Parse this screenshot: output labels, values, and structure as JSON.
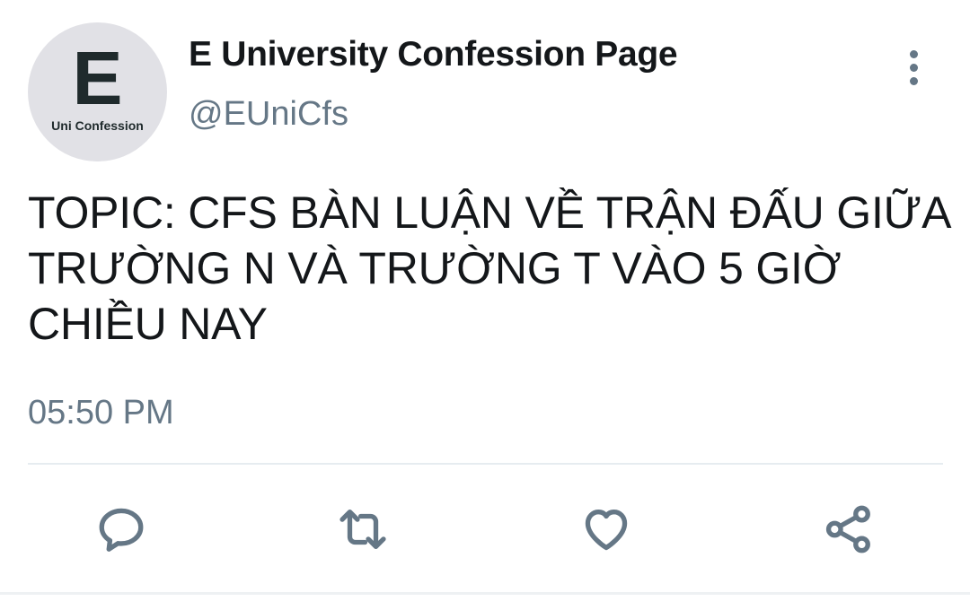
{
  "account": {
    "avatar_letter": "E",
    "avatar_caption": "Uni Confession",
    "display_name": "E University Confession Page",
    "handle": "@EUniCfs"
  },
  "tweet": {
    "text": "TOPIC: CFS BÀN LUẬN VỀ TRẬN ĐẤU GIỮA TRƯỜNG N VÀ TRƯỜNG T VÀO 5 GIỜ CHIỀU NAY",
    "timestamp": "05:50 PM"
  },
  "actions": [
    {
      "icon": "reply-icon"
    },
    {
      "icon": "retweet-icon"
    },
    {
      "icon": "like-icon"
    },
    {
      "icon": "share-icon"
    }
  ],
  "menu": {
    "icon": "more-vertical-icon"
  },
  "colors": {
    "primary_text": "#14171a",
    "secondary_text": "#657786",
    "avatar_bg": "#e1e1e6",
    "divider": "#e6ecf0"
  }
}
